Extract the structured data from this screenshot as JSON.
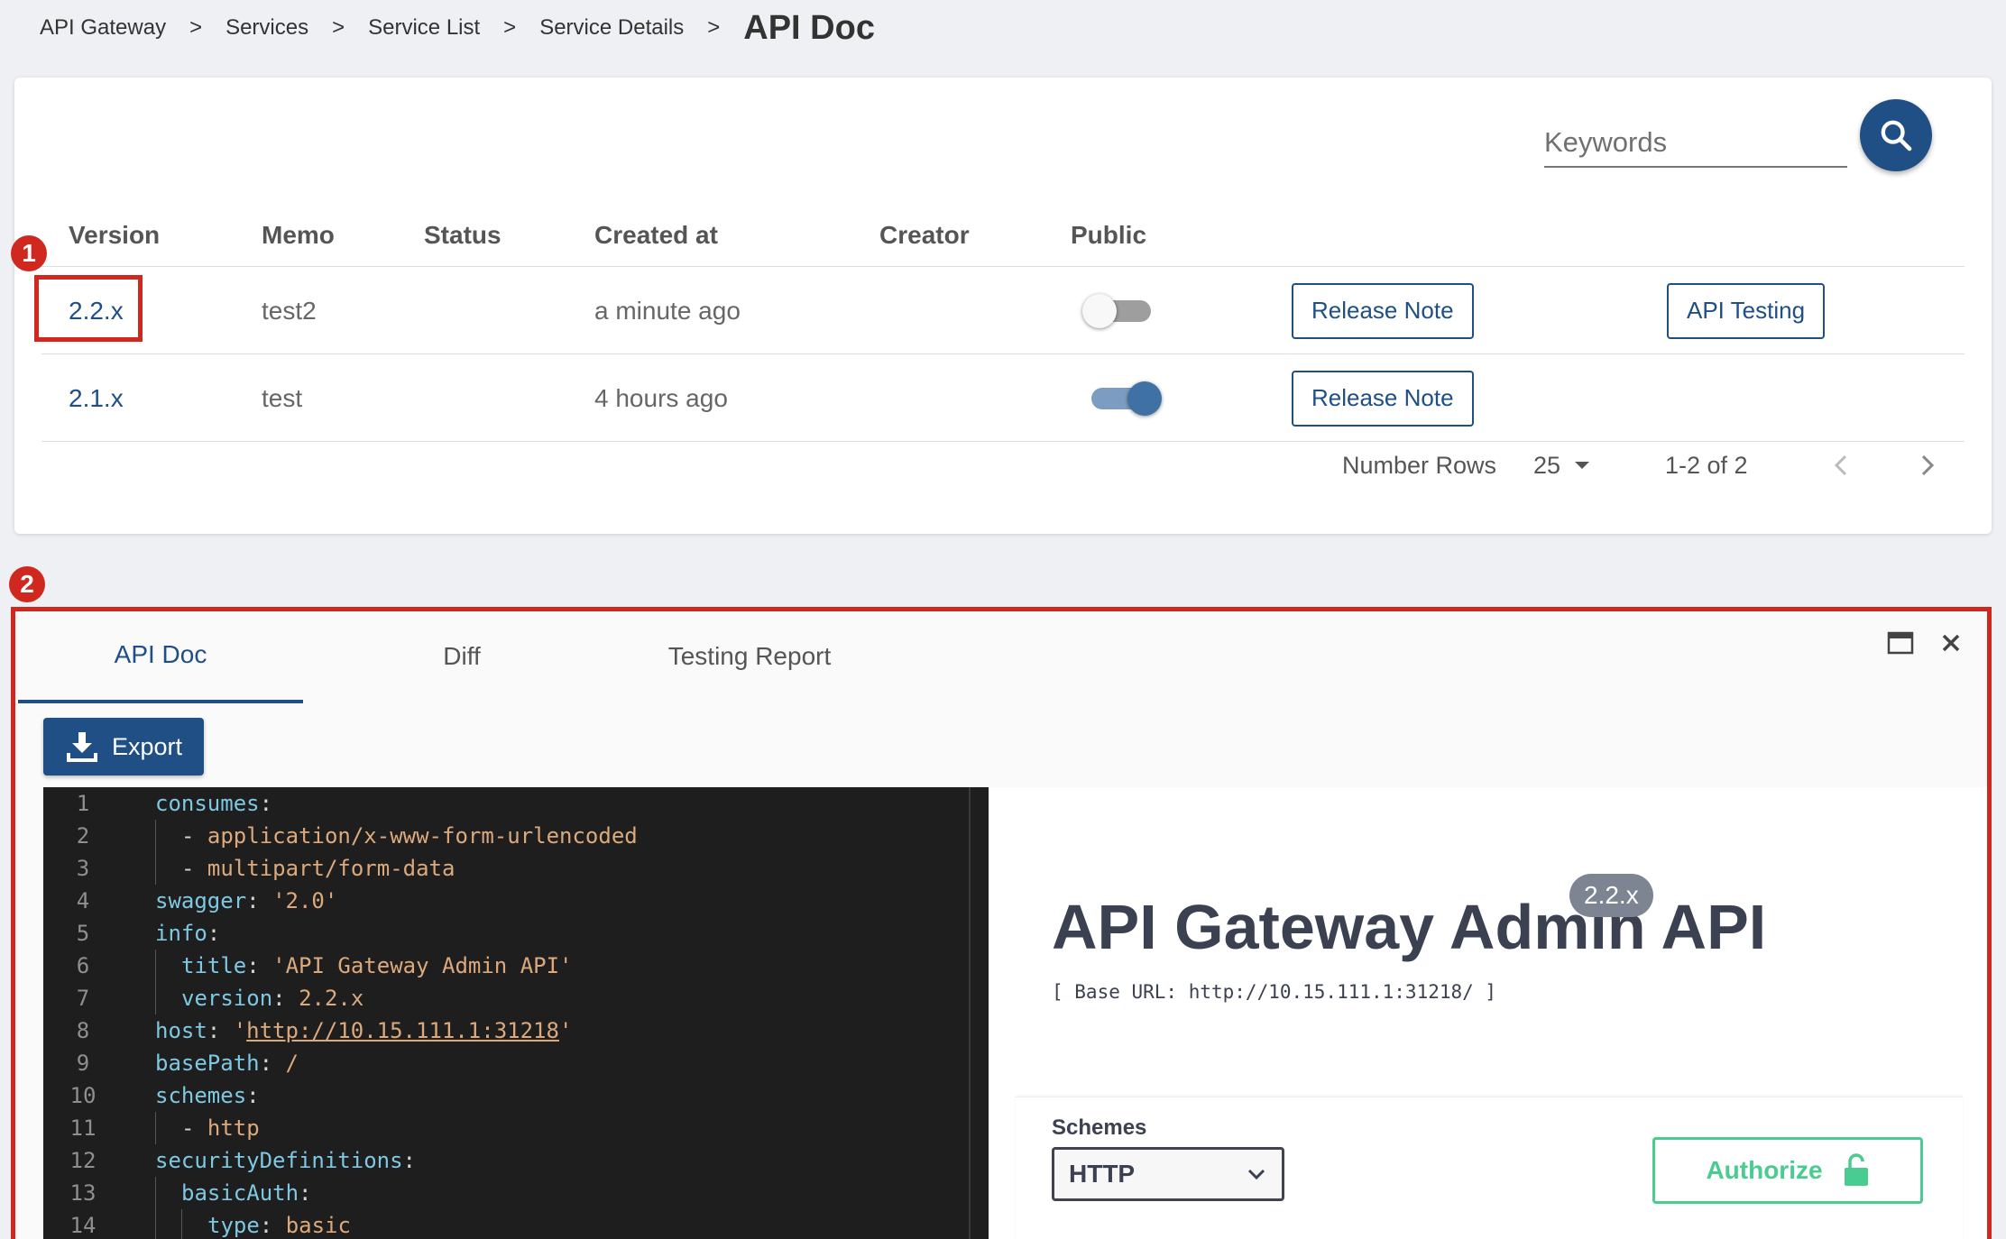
{
  "breadcrumb": {
    "items": [
      "API Gateway",
      "Services",
      "Service List",
      "Service Details"
    ],
    "separator": ">",
    "current": "API Doc"
  },
  "search": {
    "placeholder": "Keywords",
    "icon": "search-icon"
  },
  "table": {
    "headers": [
      "Version",
      "Memo",
      "Status",
      "Created at",
      "Creator",
      "Public"
    ],
    "rows": [
      {
        "version": "2.2.x",
        "memo": "test2",
        "status": "",
        "created_at": "a minute ago",
        "creator": "",
        "public": false,
        "release_note": "Release Note",
        "api_testing": "API Testing"
      },
      {
        "version": "2.1.x",
        "memo": "test",
        "status": "",
        "created_at": "4 hours ago",
        "creator": "",
        "public": true,
        "release_note": "Release Note"
      }
    ]
  },
  "pagination": {
    "rows_label": "Number Rows",
    "rows_value": "25",
    "range": "1-2 of 2"
  },
  "annotations": {
    "badge1": "1",
    "badge2": "2",
    "color": "#d0271f"
  },
  "panel": {
    "tabs": [
      {
        "label": "API Doc",
        "active": true
      },
      {
        "label": "Diff",
        "active": false
      },
      {
        "label": "Testing Report",
        "active": false
      }
    ],
    "export_label": "Export",
    "icons": [
      "maximize-icon",
      "close-icon"
    ]
  },
  "editor": {
    "lines": [
      {
        "n": "1",
        "indent": 0,
        "parts": [
          [
            "k",
            "consumes"
          ],
          [
            "p",
            ":"
          ]
        ]
      },
      {
        "n": "2",
        "indent": 1,
        "parts": [
          [
            "p",
            "- "
          ],
          [
            "s",
            "application/x-www-form-urlencoded"
          ]
        ]
      },
      {
        "n": "3",
        "indent": 1,
        "parts": [
          [
            "p",
            "- "
          ],
          [
            "s",
            "multipart/form-data"
          ]
        ]
      },
      {
        "n": "4",
        "indent": 0,
        "parts": [
          [
            "k",
            "swagger"
          ],
          [
            "p",
            ": "
          ],
          [
            "s",
            "'2.0'"
          ]
        ]
      },
      {
        "n": "5",
        "indent": 0,
        "parts": [
          [
            "k",
            "info"
          ],
          [
            "p",
            ":"
          ]
        ]
      },
      {
        "n": "6",
        "indent": 1,
        "parts": [
          [
            "k",
            "title"
          ],
          [
            "p",
            ": "
          ],
          [
            "s",
            "'API Gateway Admin API'"
          ]
        ]
      },
      {
        "n": "7",
        "indent": 1,
        "parts": [
          [
            "k",
            "version"
          ],
          [
            "p",
            ": "
          ],
          [
            "s",
            "2.2.x"
          ]
        ]
      },
      {
        "n": "8",
        "indent": 0,
        "parts": [
          [
            "k",
            "host"
          ],
          [
            "p",
            ": "
          ],
          [
            "s",
            "'"
          ],
          [
            "u",
            "http://10.15.111.1:31218"
          ],
          [
            "s",
            "'"
          ]
        ]
      },
      {
        "n": "9",
        "indent": 0,
        "parts": [
          [
            "k",
            "basePath"
          ],
          [
            "p",
            ": "
          ],
          [
            "s",
            "/"
          ]
        ]
      },
      {
        "n": "10",
        "indent": 0,
        "parts": [
          [
            "k",
            "schemes"
          ],
          [
            "p",
            ":"
          ]
        ]
      },
      {
        "n": "11",
        "indent": 1,
        "parts": [
          [
            "p",
            "- "
          ],
          [
            "s",
            "http"
          ]
        ]
      },
      {
        "n": "12",
        "indent": 0,
        "parts": [
          [
            "k",
            "securityDefinitions"
          ],
          [
            "p",
            ":"
          ]
        ]
      },
      {
        "n": "13",
        "indent": 1,
        "parts": [
          [
            "k",
            "basicAuth"
          ],
          [
            "p",
            ":"
          ]
        ]
      },
      {
        "n": "14",
        "indent": 2,
        "parts": [
          [
            "k",
            "type"
          ],
          [
            "p",
            ": "
          ],
          [
            "s",
            "basic"
          ]
        ]
      }
    ]
  },
  "preview": {
    "title": "API Gateway Admin API",
    "version": "2.2.x",
    "base_url": "[ Base URL: http://10.15.111.1:31218/ ]",
    "schemes_label": "Schemes",
    "scheme_value": "HTTP",
    "authorize_label": "Authorize"
  },
  "colors": {
    "primary": "#1f4f85",
    "success": "#49cc90",
    "annotation": "#d0271f"
  }
}
